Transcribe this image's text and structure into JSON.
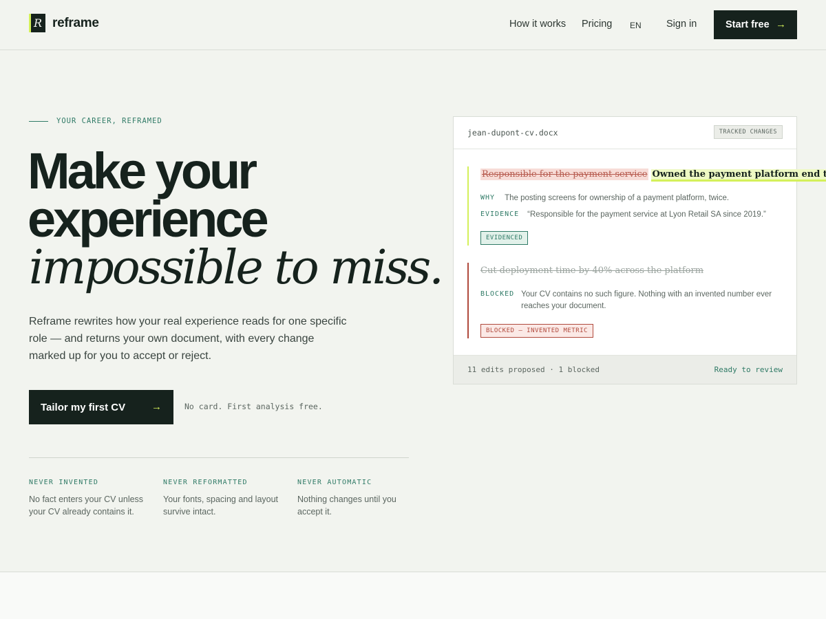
{
  "header": {
    "logo_mark": "R",
    "logo_text": "reframe",
    "nav_how": "How it works",
    "nav_pricing": "Pricing",
    "nav_lang": "EN",
    "nav_signin": "Sign in",
    "start_label": "Start free",
    "arrow": "→"
  },
  "hero": {
    "eyebrow": "YOUR CAREER, REFRAMED",
    "title_line1": "Make your",
    "title_line2": "experience",
    "title_line3": "impossible to miss.",
    "lead": "Reframe rewrites how your real experience reads for one specific role — and returns your own document, with every change marked up for you to accept or reject.",
    "cta_label": "Tailor my first CV",
    "cta_arrow": "→",
    "cta_note": "No card. First analysis free."
  },
  "features": [
    {
      "title": "NEVER INVENTED",
      "desc": "No fact enters your CV unless your CV already contains it."
    },
    {
      "title": "NEVER REFORMATTED",
      "desc": "Your fonts, spacing and layout survive intact."
    },
    {
      "title": "NEVER AUTOMATIC",
      "desc": "Nothing changes until you accept it."
    }
  ],
  "document": {
    "filename": "jean-dupont-cv.docx",
    "tracked_label": "TRACKED CHANGES",
    "edit1": {
      "deleted": "Responsible for the payment service",
      "inserted": "Owned the payment platform end to end",
      "why_key": "WHY",
      "why_text": "The posting screens for ownership of a payment platform, twice.",
      "evidence_key": "EVIDENCE",
      "evidence_text": "“Responsible for the payment service at Lyon Retail SA since 2019.”",
      "badge": "EVIDENCED"
    },
    "edit2": {
      "deleted": "Cut deployment time by 40% across the platform",
      "blocked_key": "BLOCKED",
      "blocked_text": "Your CV contains no such figure. Nothing with an invented number ever reaches your document.",
      "badge": "BLOCKED — INVENTED METRIC"
    },
    "footer_left": "11 edits proposed · 1 blocked",
    "footer_right": "Ready to review"
  },
  "colors": {
    "accent": "#d4f05a",
    "teal": "#2f7a66",
    "dark": "#16221d",
    "danger": "#b0493c"
  }
}
